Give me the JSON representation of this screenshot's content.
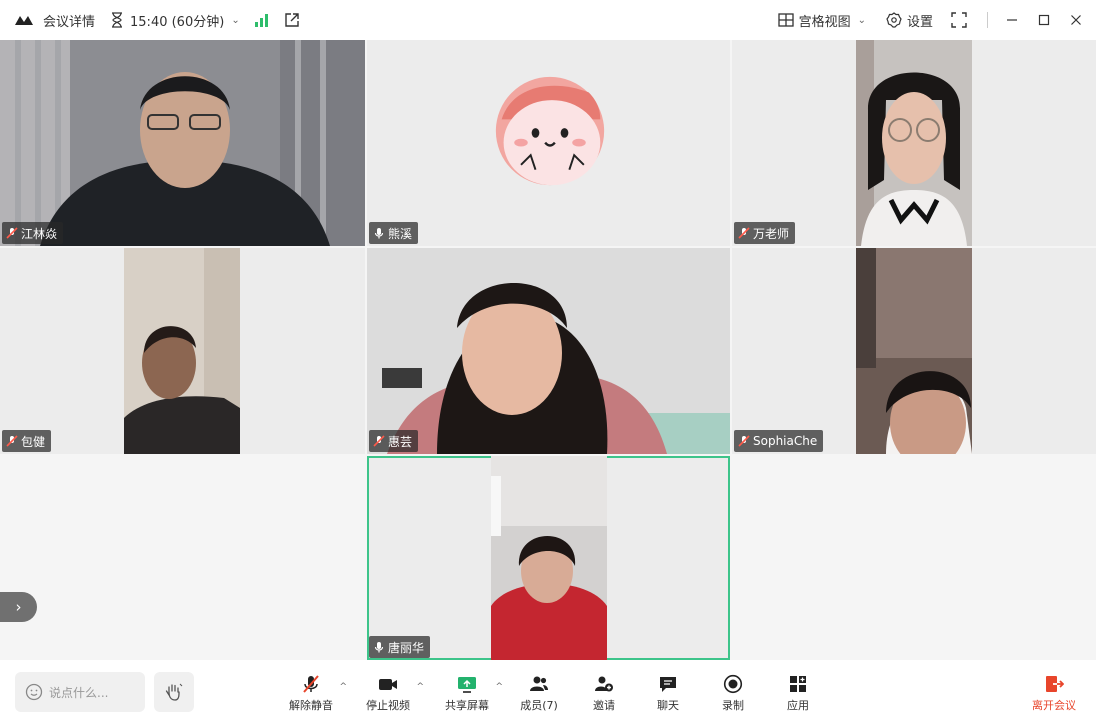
{
  "titlebar": {
    "meeting_info_label": "会议详情",
    "time": "15:40 (60分钟)",
    "gallery_view_label": "宫格视图",
    "settings_label": "设置"
  },
  "participants": [
    {
      "name": "江林焱",
      "mic": "muted"
    },
    {
      "name": "熊溪",
      "mic": "on"
    },
    {
      "name": "万老师",
      "mic": "muted"
    },
    {
      "name": "包健",
      "mic": "muted"
    },
    {
      "name": "惠芸",
      "mic": "muted"
    },
    {
      "name": "SophiaChe",
      "mic": "muted"
    },
    {
      "name": "唐丽华",
      "mic": "on"
    }
  ],
  "toolbar": {
    "chat_placeholder": "说点什么...",
    "unmute_label": "解除静音",
    "stop_video_label": "停止视频",
    "share_screen_label": "共享屏幕",
    "members_label": "成员(7)",
    "invite_label": "邀请",
    "chat_label": "聊天",
    "record_label": "录制",
    "apps_label": "应用",
    "leave_label": "离开会议"
  },
  "colors": {
    "active_speaker_border": "#3dc48a",
    "signal_green": "#2ebd6b",
    "leave_red": "#e8452b",
    "share_green": "#23b26d"
  }
}
